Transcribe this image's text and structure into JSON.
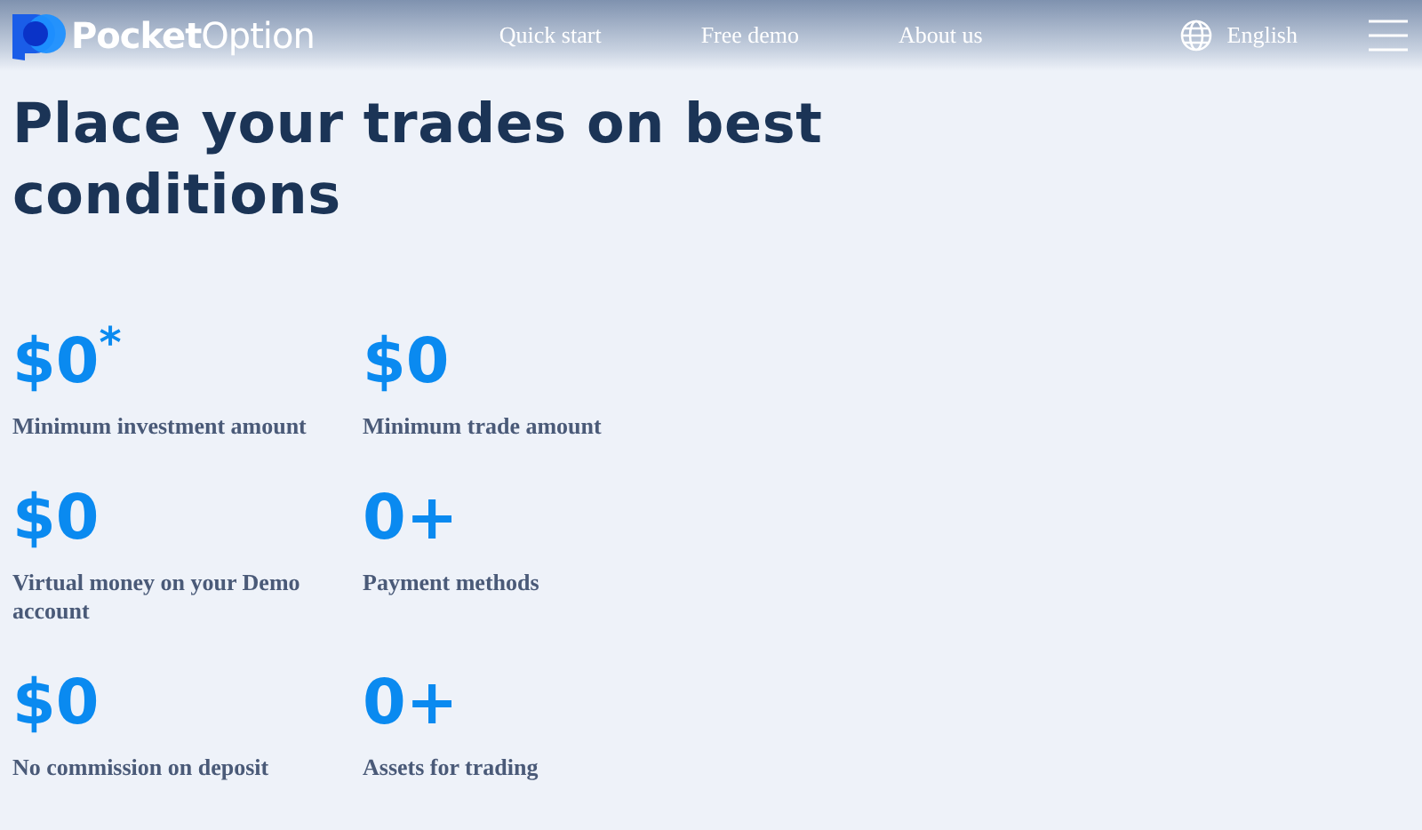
{
  "header": {
    "logo": "**Pocket**Option",
    "nav": [
      "Quick start",
      "Free demo",
      "About us"
    ],
    "language": "English"
  },
  "title": "Place your trades on best conditions",
  "stats": [
    {
      "value": "$0$^{*}$",
      "label": "Minimum investment amount"
    },
    {
      "value": "$0",
      "label": "Minimum trade amount"
    },
    {
      "value": "$0",
      "label": "Virtual money on your Demo account"
    },
    {
      "value": "0+",
      "label": "Payment methods"
    },
    {
      "value": "$0",
      "label": "No commission on deposit"
    },
    {
      "value": "0+",
      "label": "Assets for trading"
    }
  ]
}
